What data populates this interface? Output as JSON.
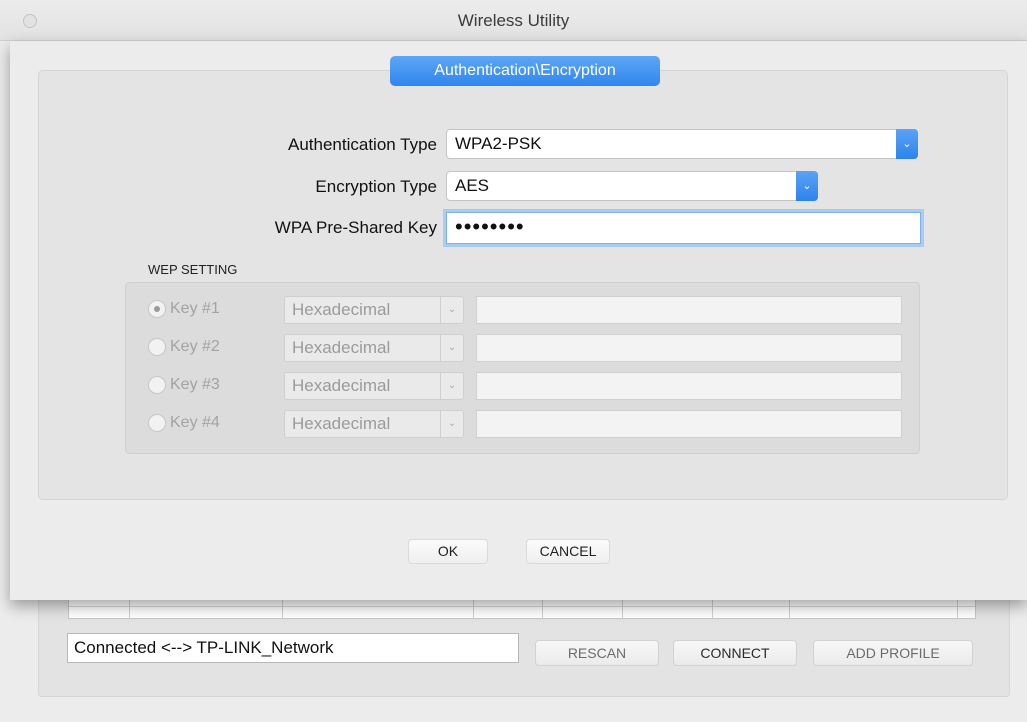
{
  "window": {
    "title": "Wireless Utility"
  },
  "tab": {
    "label": "Authentication\\Encryption"
  },
  "form": {
    "auth_type": {
      "label": "Authentication Type",
      "value": "WPA2-PSK"
    },
    "enc_type": {
      "label": "Encryption Type",
      "value": "AES"
    },
    "psk": {
      "label": "WPA Pre-Shared Key",
      "value": "••••••••"
    }
  },
  "wep": {
    "title": "WEP SETTING",
    "keys": [
      {
        "label": "Key #1",
        "format": "Hexadecimal",
        "selected": true
      },
      {
        "label": "Key #2",
        "format": "Hexadecimal",
        "selected": false
      },
      {
        "label": "Key #3",
        "format": "Hexadecimal",
        "selected": false
      },
      {
        "label": "Key #4",
        "format": "Hexadecimal",
        "selected": false
      }
    ]
  },
  "dialog_buttons": {
    "ok": "OK",
    "cancel": "CANCEL"
  },
  "main": {
    "status": "Connected <--> TP-LINK_Network",
    "rescan": "RESCAN",
    "connect": "CONNECT",
    "add_profile": "ADD PROFILE"
  },
  "colors": {
    "accent": "#2f86ee",
    "disabled_text": "#a3a3a3"
  }
}
